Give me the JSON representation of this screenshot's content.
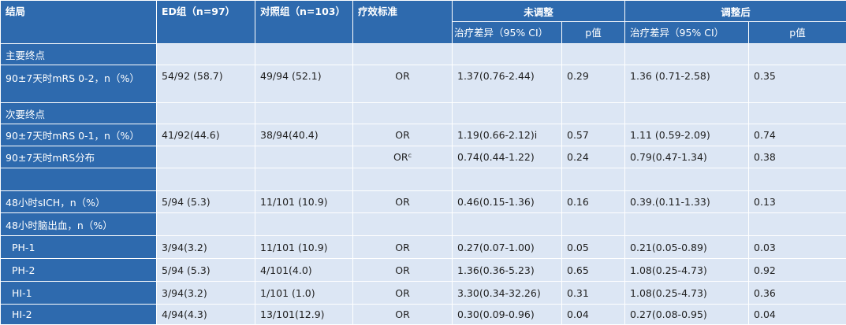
{
  "header": {
    "outcome": "结局",
    "ed_group": "ED组（n=97）",
    "control_group": "对照组（n=103）",
    "efficacy_measure": "疗效标准",
    "unadjusted": "未调整",
    "adjusted": "调整后",
    "diff_ci_unadj": "治疗差异（95% CI）",
    "pvalue_unadj": "p值",
    "diff_ci_adj": "治疗差异（95% CI）",
    "pvalue_adj": "p值"
  },
  "rows": [
    {
      "label": "主要终点",
      "ed": "",
      "ctrl": "",
      "measure": "",
      "measure_sup": "",
      "d1": "",
      "p1": "",
      "d2": "",
      "p2": ""
    },
    {
      "label": "90±7天时mRS 0-2，n（%）",
      "ed": "54/92 (58.7)",
      "ctrl": "49/94 (52.1)",
      "measure": "OR",
      "measure_sup": "",
      "d1": "1.37(0.76-2.44)",
      "p1": "0.29",
      "d2": "1.36 (0.71-2.58)",
      "p2": "0.35"
    },
    {
      "label": "次要终点",
      "ed": "",
      "ctrl": "",
      "measure": "",
      "measure_sup": "",
      "d1": "",
      "p1": "",
      "d2": "",
      "p2": ""
    },
    {
      "label": "90±7天时mRS 0-1，n（%）",
      "ed": "41/92(44.6)",
      "ctrl": "38/94(40.4)",
      "measure": "OR",
      "measure_sup": "",
      "d1": "1.19(0.66-2.12)i",
      "p1": "0.57",
      "d2": "1.11 (0.59-2.09)",
      "p2": "0.74"
    },
    {
      "label": "90±7天时mRS分布",
      "ed": "",
      "ctrl": "",
      "measure": "OR",
      "measure_sup": "c",
      "d1": "0.74(0.44-1.22)",
      "p1": "0.24",
      "d2": "0.79(0.47-1.34)",
      "p2": "0.38"
    },
    {
      "label": "",
      "ed": "",
      "ctrl": "",
      "measure": "",
      "measure_sup": "",
      "d1": "",
      "p1": "",
      "d2": "",
      "p2": ""
    },
    {
      "label": "48小时sICH，n（%）",
      "ed": "5/94 (5.3)",
      "ctrl": "11/101 (10.9)",
      "measure": "OR",
      "measure_sup": "",
      "d1": "0.46(0.15-1.36)",
      "p1": "0.16",
      "d2": "0.39.(0.11-1.33)",
      "p2": "0.13"
    },
    {
      "label": "48小时脑出血，n（%）",
      "ed": "",
      "ctrl": "",
      "measure": "",
      "measure_sup": "",
      "d1": "",
      "p1": "",
      "d2": "",
      "p2": ""
    },
    {
      "label": "PH-1",
      "ed": "3/94(3.2)",
      "ctrl": "11/101 (10.9)",
      "measure": "OR",
      "measure_sup": "",
      "d1": "0.27(0.07-1.00)",
      "p1": "0.05",
      "d2": "0.21(0.05-0.89)",
      "p2": "0.03"
    },
    {
      "label": "PH-2",
      "ed": "5/94 (5.3)",
      "ctrl": "4/101(4.0)",
      "measure": "OR",
      "measure_sup": "",
      "d1": "1.36(0.36-5.23)",
      "p1": "0.65",
      "d2": "1.08(0.25-4.73)",
      "p2": "0.92"
    },
    {
      "label": "HI-1",
      "ed": "3/94(3.2)",
      "ctrl": "1/101 (1.0)",
      "measure": "OR",
      "measure_sup": "",
      "d1": "3.30(0.34-32.26)",
      "p1": "0.31",
      "d2": "1.08(0.25-4.73)",
      "p2": "0.36"
    },
    {
      "label": "HI-2",
      "ed": "4/94(4.3)",
      "ctrl": "13/101(12.9)",
      "measure": "OR",
      "measure_sup": "",
      "d1": "0.30(0.09-0.96)",
      "p1": "0.04",
      "d2": "0.27(0.08-0.95)",
      "p2": "0.04"
    }
  ],
  "colors": {
    "header_bg": "#2e6aae",
    "cell_bg": "#dce6f4",
    "header_text": "#ffffff"
  }
}
